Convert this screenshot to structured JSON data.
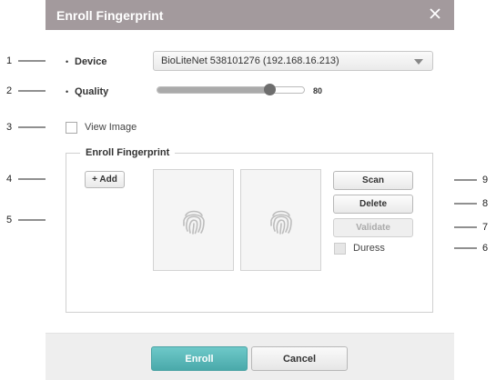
{
  "dialog": {
    "title": "Enroll Fingerprint",
    "close_icon": "close-icon"
  },
  "form": {
    "device_label": "Device",
    "device_value": "BioLiteNet 538101276 (192.168.16.213)",
    "quality_label": "Quality",
    "quality_value": "80",
    "quality_fraction": 0.8,
    "view_image_label": "View Image",
    "view_image_checked": false
  },
  "group": {
    "title": "Enroll Fingerprint",
    "add_label": "+ Add",
    "fingerprint_icon": "fingerprint-icon",
    "scan_label": "Scan",
    "delete_label": "Delete",
    "validate_label": "Validate",
    "duress_label": "Duress",
    "duress_checked": false
  },
  "footer": {
    "enroll_label": "Enroll",
    "cancel_label": "Cancel"
  },
  "callouts": {
    "n1": "1",
    "n2": "2",
    "n3": "3",
    "n4": "4",
    "n5": "5",
    "n6": "6",
    "n7": "7",
    "n8": "8",
    "n9": "9"
  },
  "colors": {
    "titlebar": "#a39a9d",
    "enroll_button": "#4aa9aa"
  }
}
